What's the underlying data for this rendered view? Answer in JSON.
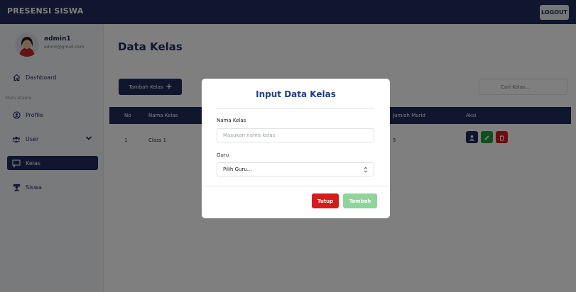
{
  "header": {
    "brand": "PRESENSI SISWA",
    "logout_label": "LOGOUT"
  },
  "sidebar": {
    "user": {
      "name": "admin1",
      "email": "admin@gmail.com"
    },
    "dashboard_label": "Dashboard",
    "section_label": "Main Utama",
    "items": [
      {
        "label": "Profile",
        "icon": "profile-icon"
      },
      {
        "label": "User",
        "icon": "users-icon"
      },
      {
        "label": "Kelas",
        "icon": "class-icon"
      },
      {
        "label": "Siswa",
        "icon": "student-icon"
      }
    ]
  },
  "main": {
    "title": "Data Kelas",
    "add_button_label": "Tambah Kelas",
    "search_placeholder": "Cari Kelas...",
    "table": {
      "headers": [
        "No",
        "Nama Kelas",
        "Jumlah Murid",
        "Aksi"
      ],
      "rows": [
        {
          "no": "1",
          "nama_kelas": "Class 1",
          "jumlah_murid": "5"
        }
      ]
    }
  },
  "modal": {
    "title": "Input Data Kelas",
    "nama_label": "Nama Kelas",
    "nama_placeholder": "Masukan nama kelas",
    "guru_label": "Guru",
    "guru_selected": "Pilih Guru...",
    "close_label": "Tutup",
    "submit_label": "Tambah"
  },
  "colors": {
    "primary": "#1f2d5a",
    "danger": "#d71a1a",
    "success": "#8fd49a",
    "accent_blue": "#1f3f8a"
  }
}
